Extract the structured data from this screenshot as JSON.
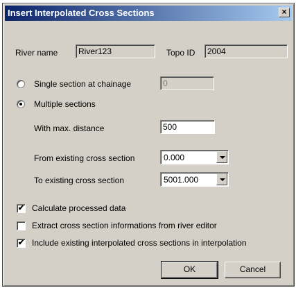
{
  "window": {
    "title": "Insert Interpolated Cross Sections",
    "close_glyph": "×"
  },
  "river": {
    "label": "River name",
    "value": "River123"
  },
  "topo": {
    "label": "Topo ID",
    "value": "2004"
  },
  "single_section": {
    "label": "Single section at chainage",
    "value": "0",
    "selected": false
  },
  "multiple_sections": {
    "label": "Multiple sections",
    "selected": true
  },
  "max_distance": {
    "label": "With max. distance",
    "value": "500"
  },
  "from_section": {
    "label": "From existing cross section",
    "value": "0.000"
  },
  "to_section": {
    "label": "To existing cross section",
    "value": "5001.000"
  },
  "options": {
    "calc_processed": {
      "label": "Calculate processed data",
      "checked": true
    },
    "extract_info": {
      "label": "Extract cross section informations from river editor",
      "checked": false
    },
    "include_existing": {
      "label": "Include existing interpolated cross sections in interpolation",
      "checked": true
    }
  },
  "buttons": {
    "ok": "OK",
    "cancel": "Cancel"
  },
  "check_glyph": "✔"
}
